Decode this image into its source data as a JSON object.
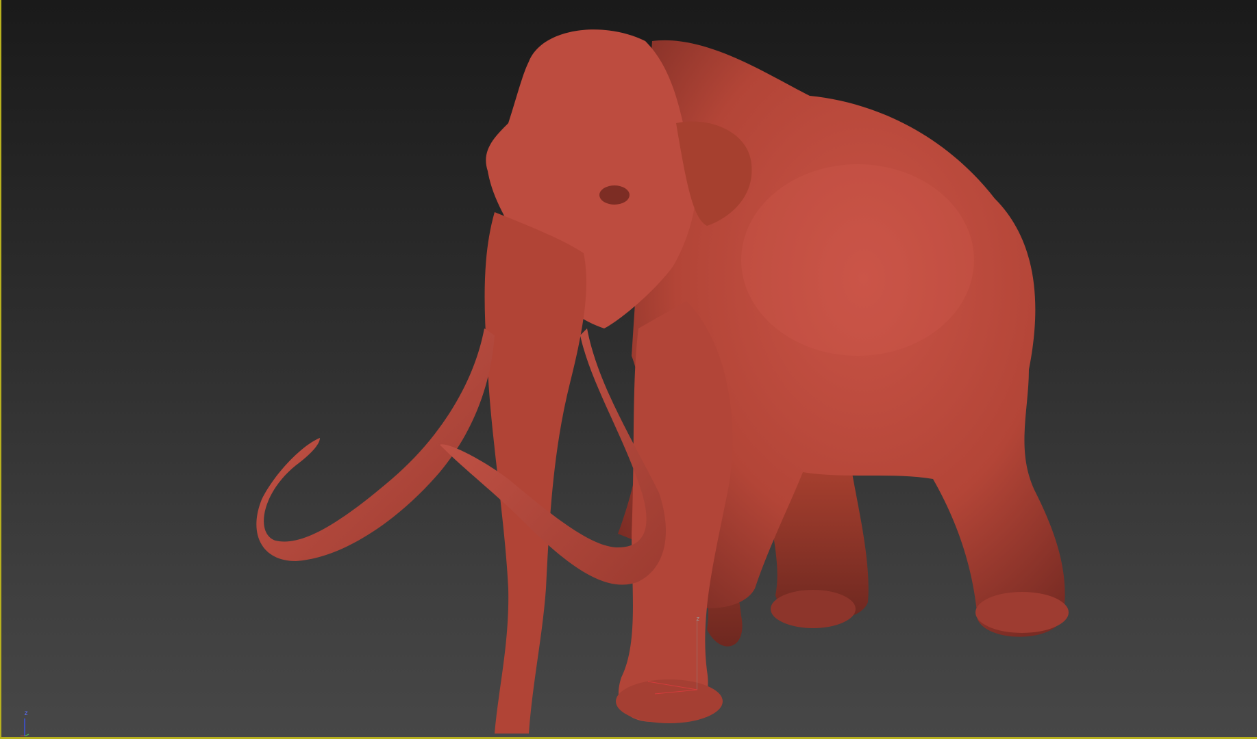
{
  "viewport": {
    "background_top": "#1a1a1a",
    "background_bottom": "#474747",
    "active_border_color": "#b8b11f"
  },
  "model": {
    "icon": "mammoth-sculpt",
    "material_color": "#b84a3e"
  },
  "axis_gizmo": {
    "z_label": "z",
    "x_color": "#d23c3c",
    "y_color": "#4caf50",
    "z_color": "#3c50dc"
  },
  "pivot_gizmo": {
    "z_label": "z"
  }
}
